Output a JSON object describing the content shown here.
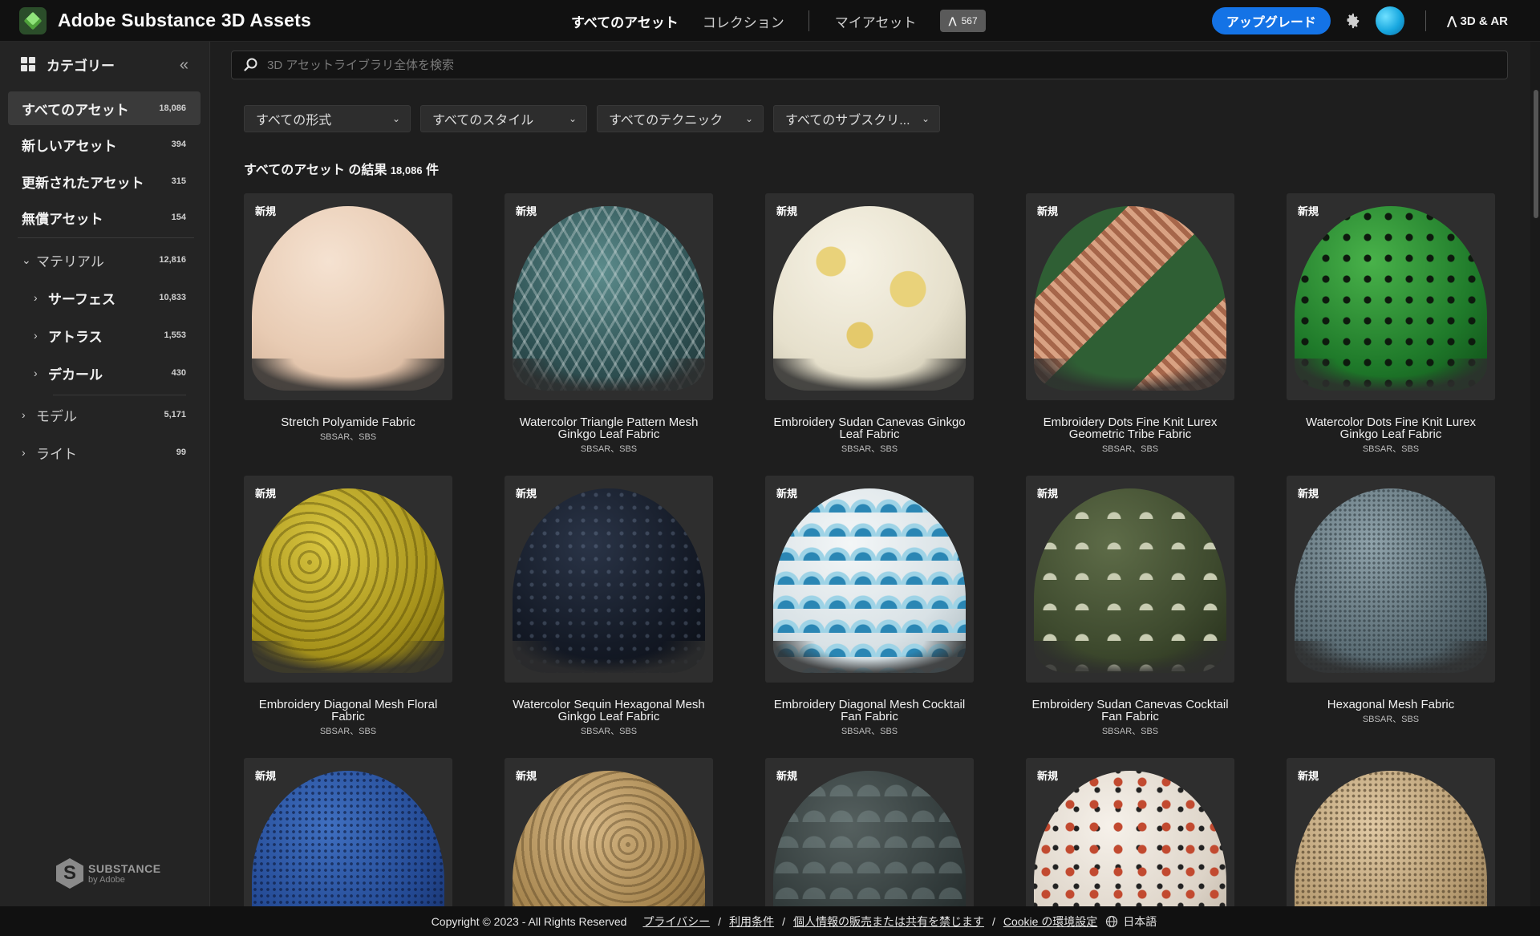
{
  "header": {
    "app_title": "Adobe Substance 3D Assets",
    "nav": [
      {
        "label": "すべてのアセット",
        "active": true
      },
      {
        "label": "コレクション",
        "active": false
      },
      {
        "label": "マイアセット",
        "active": false
      }
    ],
    "credits_badge": "567",
    "upgrade_label": "アップグレード",
    "ar_label": "3D & AR",
    "accent_color": "#1473e6"
  },
  "sidebar": {
    "title": "カテゴリー",
    "items": [
      {
        "label": "すべてのアセット",
        "count": "18,086"
      },
      {
        "label": "新しいアセット",
        "count": "394"
      },
      {
        "label": "更新されたアセット",
        "count": "315"
      },
      {
        "label": "無償アセット",
        "count": "154"
      },
      {
        "label": "マテリアル",
        "count": "12,816"
      },
      {
        "label": "サーフェス",
        "count": "10,833"
      },
      {
        "label": "アトラス",
        "count": "1,553"
      },
      {
        "label": "デカール",
        "count": "430"
      },
      {
        "label": "モデル",
        "count": "5,171"
      },
      {
        "label": "ライト",
        "count": "99"
      }
    ],
    "logo_text": "SUBSTANCE",
    "logo_sub": "by Adobe"
  },
  "search": {
    "placeholder": "3D アセットライブラリ全体を検索",
    "value": ""
  },
  "filters": [
    "すべての形式",
    "すべてのスタイル",
    "すべてのテクニック",
    "すべてのサブスクリ..."
  ],
  "results": {
    "prefix": "すべてのアセット の結果",
    "count": "18,086",
    "suffix": "件"
  },
  "new_tag": "新規",
  "assets": [
    {
      "name": "Stretch Polyamide Fabric",
      "formats": "SBSAR、SBS",
      "texture": "d-peach"
    },
    {
      "name": "Watercolor Triangle Pattern Mesh Ginkgo Leaf Fabric",
      "formats": "SBSAR、SBS",
      "texture": "d-tri-teal"
    },
    {
      "name": "Embroidery Sudan Canevas Ginkgo Leaf Fabric",
      "formats": "SBSAR、SBS",
      "texture": "d-yellow-white"
    },
    {
      "name": "Embroidery Dots Fine Knit Lurex Geometric Tribe Fabric",
      "formats": "SBSAR、SBS",
      "texture": "d-tribe"
    },
    {
      "name": "Watercolor Dots Fine Knit Lurex Ginkgo Leaf Fabric",
      "formats": "SBSAR、SBS",
      "texture": "d-green-dots"
    },
    {
      "name": "Embroidery Diagonal Mesh Floral Fabric",
      "formats": "SBSAR、SBS",
      "texture": "d-yellow-lace"
    },
    {
      "name": "Watercolor Sequin Hexagonal Mesh Ginkgo Leaf Fabric",
      "formats": "SBSAR、SBS",
      "texture": "d-navy-sequin"
    },
    {
      "name": "Embroidery Diagonal Mesh Cocktail Fan Fabric",
      "formats": "SBSAR、SBS",
      "texture": "d-fan-blue"
    },
    {
      "name": "Embroidery Sudan Canevas Cocktail Fan Fabric",
      "formats": "SBSAR、SBS",
      "texture": "d-fan-olive"
    },
    {
      "name": "Hexagonal Mesh Fabric",
      "formats": "SBSAR、SBS",
      "texture": "d-hex-gray"
    },
    {
      "name": "",
      "formats": "",
      "texture": "d-blue-mesh"
    },
    {
      "name": "",
      "formats": "",
      "texture": "d-sand-lace"
    },
    {
      "name": "",
      "formats": "",
      "texture": "d-dark-fan"
    },
    {
      "name": "",
      "formats": "",
      "texture": "d-red-splatter"
    },
    {
      "name": "",
      "formats": "",
      "texture": "d-beige-mesh"
    }
  ],
  "footer": {
    "copyright": "Copyright © 2023 - All Rights Reserved",
    "links": [
      "プライバシー",
      "利用条件",
      "個人情報の販売または共有を禁じます",
      "Cookie の環境設定"
    ],
    "language": "日本語"
  }
}
